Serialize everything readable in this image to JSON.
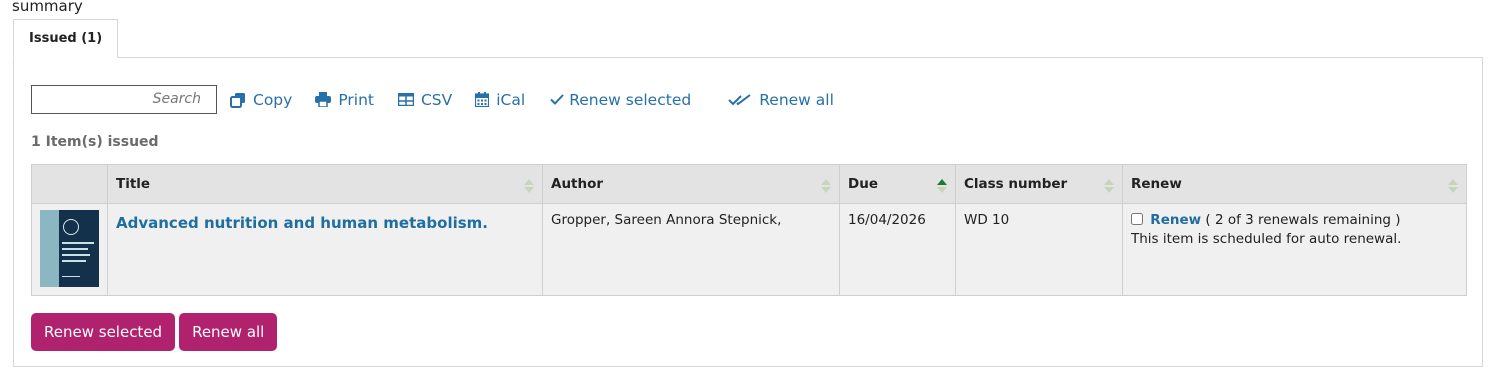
{
  "page": {
    "heading": "summary"
  },
  "tabs": [
    {
      "label": "Issued (1)",
      "active": true
    }
  ],
  "toolbar": {
    "search_placeholder": "Search",
    "copy_label": "Copy",
    "print_label": "Print",
    "csv_label": "CSV",
    "ical_label": "iCal",
    "renew_selected_label": "Renew selected",
    "renew_all_label": "Renew all"
  },
  "summary": {
    "items_issued": "1 Item(s) issued"
  },
  "table": {
    "headers": {
      "title": "Title",
      "author": "Author",
      "due": "Due",
      "class_number": "Class number",
      "renew": "Renew"
    },
    "sorted_column": "Due",
    "rows": [
      {
        "title": "Advanced nutrition and human metabolism.",
        "author": "Gropper, Sareen Annora Stepnick,",
        "due": "16/04/2026",
        "class_number": "WD 10",
        "renew_link": "Renew",
        "renewals_remaining": "( 2 of 3 renewals remaining )",
        "auto_renew_note": "This item is scheduled for auto renewal.",
        "renew_checked": false,
        "cover_icon": "book-cover-icon"
      }
    ]
  },
  "actions": {
    "renew_selected": "Renew selected",
    "renew_all": "Renew all"
  },
  "colors": {
    "link": "#1f6e9f",
    "toolbar_link": "#2870a8",
    "primary_button": "#b0216e",
    "header_bg": "#e3e3e3",
    "row_bg": "#f0f0f0"
  }
}
